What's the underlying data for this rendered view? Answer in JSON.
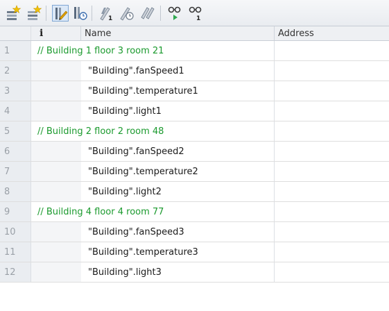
{
  "toolbar": {
    "buttons": [
      {
        "icon": "insert-row-icon"
      },
      {
        "icon": "add-row-icon"
      },
      {
        "icon": "show-hide-columns-icon"
      },
      {
        "icon": "monitor-values-icon"
      },
      {
        "icon": "modify-now-icon"
      },
      {
        "icon": "modify-with-trigger-icon"
      },
      {
        "icon": "enable-peripheral-outputs-icon"
      },
      {
        "icon": "monitor-all-icon"
      },
      {
        "icon": "monitor-once-icon"
      }
    ]
  },
  "table": {
    "columns": {
      "info": "i",
      "name": "Name",
      "address": "Address"
    },
    "rows": [
      {
        "num": "1",
        "type": "comment",
        "text": "// Building 1 floor 3 room 21"
      },
      {
        "num": "2",
        "type": "data",
        "name": "\"Building\".fanSpeed1",
        "address": ""
      },
      {
        "num": "3",
        "type": "data",
        "name": "\"Building\".temperature1",
        "address": ""
      },
      {
        "num": "4",
        "type": "data",
        "name": "\"Building\".light1",
        "address": ""
      },
      {
        "num": "5",
        "type": "comment",
        "text": "// Building 2 floor 2 room 48"
      },
      {
        "num": "6",
        "type": "data",
        "name": "\"Building\".fanSpeed2",
        "address": ""
      },
      {
        "num": "7",
        "type": "data",
        "name": "\"Building\".temperature2",
        "address": ""
      },
      {
        "num": "8",
        "type": "data",
        "name": "\"Building\".light2",
        "address": ""
      },
      {
        "num": "9",
        "type": "comment",
        "text": "// Building 4 floor 4 room 77"
      },
      {
        "num": "10",
        "type": "data",
        "name": "\"Building\".fanSpeed3",
        "address": ""
      },
      {
        "num": "11",
        "type": "data",
        "name": "\"Building\".temperature3",
        "address": ""
      },
      {
        "num": "12",
        "type": "data",
        "name": "\"Building\".light3",
        "address": ""
      }
    ]
  },
  "colors": {
    "comment": "#1b9a2e",
    "rowNumber": "#9aa0a7",
    "gridLine": "#dedede"
  }
}
